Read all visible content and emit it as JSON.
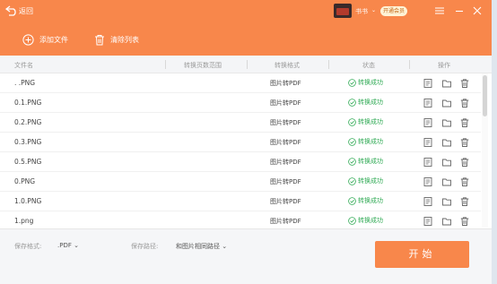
{
  "titlebar": {
    "back_label": "返回",
    "book_label": "书书",
    "vip_label": "开通会员",
    "accent_color": "#f8874b"
  },
  "toolbar": {
    "add_label": "添加文件",
    "clear_label": "清除列表"
  },
  "table": {
    "headers": [
      "文件名",
      "转换页数范围",
      "转换格式",
      "状态",
      "操作"
    ],
    "rows": [
      {
        "name": ".  .PNG",
        "format": "图片转PDF",
        "status": "转换成功"
      },
      {
        "name": "0.1.PNG",
        "format": "图片转PDF",
        "status": "转换成功"
      },
      {
        "name": "0.2.PNG",
        "format": "图片转PDF",
        "status": "转换成功"
      },
      {
        "name": "0.3.PNG",
        "format": "图片转PDF",
        "status": "转换成功"
      },
      {
        "name": "0.5.PNG",
        "format": "图片转PDF",
        "status": "转换成功"
      },
      {
        "name": "0.PNG",
        "format": "图片转PDF",
        "status": "转换成功"
      },
      {
        "name": "1.0.PNG",
        "format": "图片转PDF",
        "status": "转换成功"
      },
      {
        "name": "1.png",
        "format": "图片转PDF",
        "status": "转换成功"
      }
    ],
    "success_color": "#2faa54"
  },
  "footer": {
    "save_format_label": "保存格式:",
    "save_format_value": ".PDF",
    "save_path_label": "保存路径:",
    "save_path_value": "和图片相同路径",
    "start_label": "开始"
  }
}
